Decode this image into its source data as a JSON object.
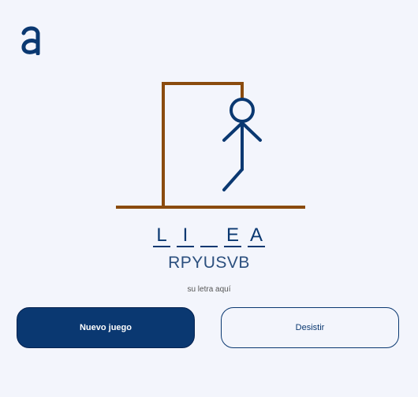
{
  "logo": {
    "icon": "alura-logo-icon",
    "color": "#0a3871"
  },
  "game": {
    "word_slots": [
      "L",
      "I",
      "",
      "E",
      "A"
    ],
    "wrong_letters": "RPYUSVB",
    "input_placeholder": "su letra aquí",
    "gallows_color": "#8a4b0e",
    "figure_color": "#0a3871"
  },
  "buttons": {
    "new_game": "Nuevo juego",
    "give_up": "Desistir"
  }
}
